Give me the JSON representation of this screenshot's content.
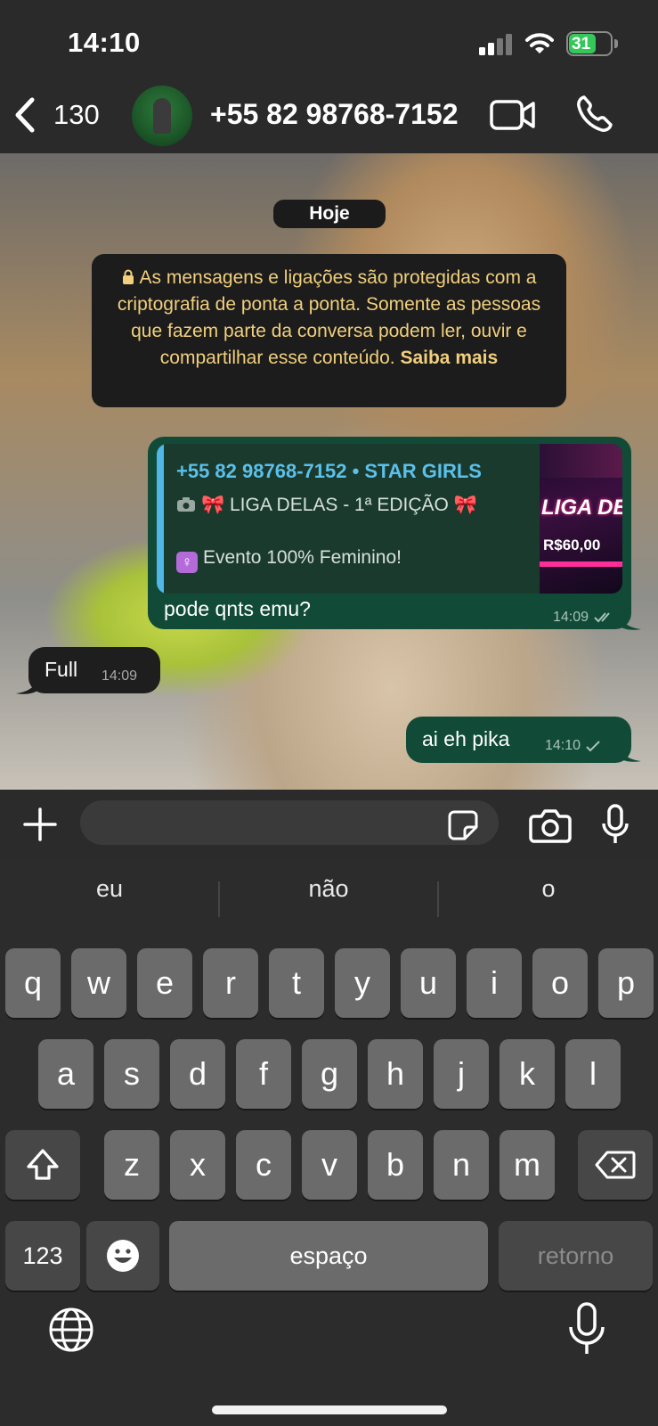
{
  "status_bar": {
    "time": "14:10",
    "battery": "31"
  },
  "header": {
    "back_count": "130",
    "contact_name": "+55 82 98768-7152",
    "icons": [
      "chevron-left-icon",
      "video-call-icon",
      "phone-icon"
    ]
  },
  "chat": {
    "date_separator": "Hoje",
    "encryption_notice": {
      "text": "As mensagens e ligações são protegidas com a criptografia de ponta a ponta. Somente as pessoas que fazem parte da conversa podem ler, ouvir e compartilhar esse conteúdo.",
      "link": "Saiba mais"
    },
    "messages": [
      {
        "direction": "outgoing",
        "quote": {
          "author": "+55 82 98768-7152 • STAR GIRLS",
          "line1": "LIGA DELAS - 1ª EDIÇÃO",
          "line2": "Evento 100% Feminino!",
          "thumbnail_title": "LIGA DELAS",
          "thumbnail_price": "R$60,00"
        },
        "text": "pode qnts emu?",
        "time": "14:09",
        "status": "delivered"
      },
      {
        "direction": "incoming",
        "text": "Full",
        "time": "14:09"
      },
      {
        "direction": "outgoing",
        "text": "ai eh pika",
        "time": "14:10",
        "status": "sent"
      }
    ]
  },
  "composer": {
    "input_value": "",
    "icons": [
      "plus-icon",
      "sticker-icon",
      "camera-icon",
      "microphone-icon"
    ]
  },
  "keyboard": {
    "suggestions": [
      "eu",
      "não",
      "o"
    ],
    "row1": [
      "q",
      "w",
      "e",
      "r",
      "t",
      "y",
      "u",
      "i",
      "o",
      "p"
    ],
    "row2": [
      "a",
      "s",
      "d",
      "f",
      "g",
      "h",
      "j",
      "k",
      "l"
    ],
    "row3": [
      "z",
      "x",
      "c",
      "v",
      "b",
      "n",
      "m"
    ],
    "numbers_label": "123",
    "space_label": "espaço",
    "return_label": "retorno"
  },
  "colors": {
    "outgoing_bubble": "#114b38",
    "incoming_bubble": "#1e1e1e",
    "notice_text": "#f1cf7c",
    "quote_author": "#5bc0ea"
  }
}
